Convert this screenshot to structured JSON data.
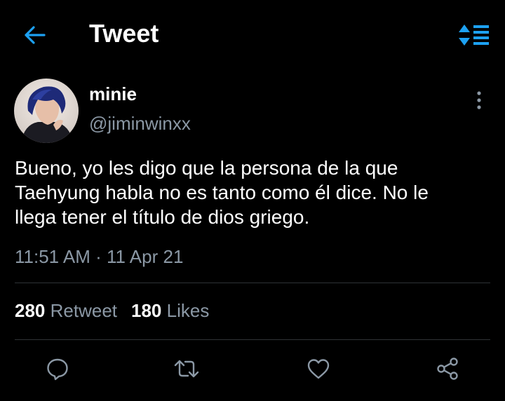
{
  "header": {
    "title": "Tweet",
    "back_icon": "arrow-left-icon",
    "sort_icon": "sort-list-icon"
  },
  "author": {
    "display_name": "minie",
    "handle": "@jiminwinxx"
  },
  "tweet": {
    "text_lines": [
      "Bueno, yo les digo que la persona de la que",
      "Taehyung habla no es tanto como él dice. No le",
      "llega tener el título de dios griego."
    ],
    "timestamp": "11:51 AM · 11 Apr 21"
  },
  "stats": {
    "retweets_count": "280",
    "retweets_label": "Retweet",
    "likes_count": "180",
    "likes_label": "Likes"
  },
  "actions": [
    "reply-icon",
    "retweet-icon",
    "like-icon",
    "share-icon"
  ],
  "colors": {
    "background": "#000000",
    "text_primary": "#ffffff",
    "text_secondary": "#8b98a5",
    "accent": "#1da1f2",
    "divider": "#2f3336"
  }
}
